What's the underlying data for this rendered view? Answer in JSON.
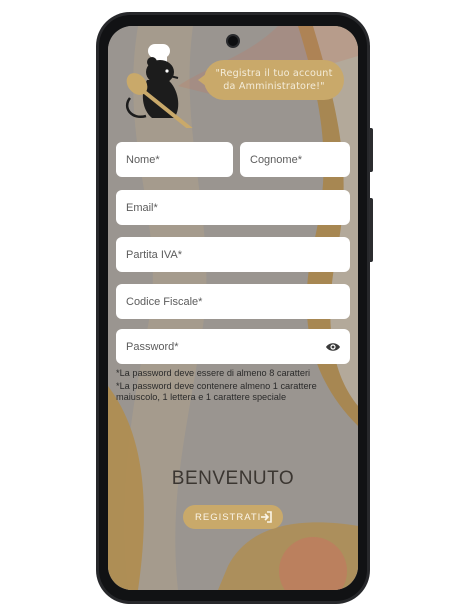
{
  "bubble": {
    "line1": "\"Registra il tuo account",
    "line2": "da Amministratore!\""
  },
  "form": {
    "nome_placeholder": "Nome*",
    "cognome_placeholder": "Cognome*",
    "email_placeholder": "Email*",
    "piva_placeholder": "Partita IVA*",
    "cf_placeholder": "Codice Fiscale*",
    "password_placeholder": "Password*"
  },
  "notes": {
    "line1": "*La password deve essere di almeno 8 caratteri",
    "line2": "*La password deve contenere almeno 1 carattere",
    "line3": "maiuscolo, 1 lettera e 1 carattere speciale"
  },
  "welcome": "BENVENUTO",
  "register_button": "REGISTRATI",
  "icons": {
    "logo": "chef-rat-logo",
    "password_toggle": "eye-icon",
    "register": "login-arrow-icon"
  },
  "colors": {
    "accent": "#c9a96a",
    "background": "#9a9590",
    "field": "#ffffff"
  }
}
